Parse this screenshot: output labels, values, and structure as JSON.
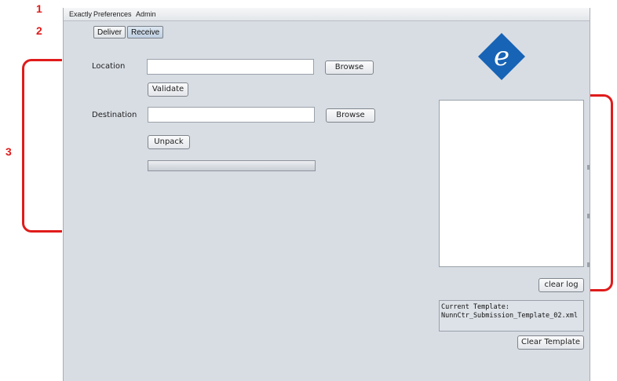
{
  "callouts": {
    "one": "1",
    "two": "2",
    "three": "3"
  },
  "menu": {
    "items": [
      "Exactly",
      "Preferences",
      "Admin"
    ]
  },
  "tabs": [
    {
      "label": "Deliver",
      "active": false
    },
    {
      "label": "Receive",
      "active": true
    }
  ],
  "form": {
    "location_label": "Location",
    "location_value": "",
    "browse_label": "Browse",
    "validate_label": "Validate",
    "destination_label": "Destination",
    "destination_value": "",
    "browse2_label": "Browse",
    "unpack_label": "Unpack",
    "progress": 0
  },
  "logo": {
    "letter": "e",
    "color": "#1763b5"
  },
  "log": {
    "clear_label": "clear log"
  },
  "template": {
    "heading": "Current Template:",
    "name": "NunnCtr_Submission_Template_02.xml",
    "clear_label": "Clear Template"
  },
  "colors": {
    "callout": "#e01b1b",
    "panel": "#d8dde4"
  }
}
